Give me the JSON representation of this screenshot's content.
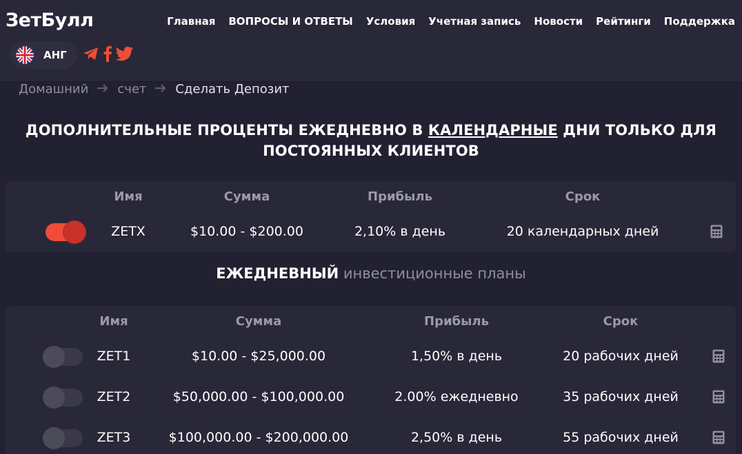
{
  "header": {
    "logo": "ЗетБулл",
    "nav": [
      "Главная",
      "ВОПРОСЫ И ОТВЕТЫ",
      "Условия",
      "Учетная запись",
      "Новости",
      "Рейтинги",
      "Поддержка"
    ],
    "language": "АНГ"
  },
  "breadcrumb": [
    "Домашний",
    "счет",
    "Сделать Депозит"
  ],
  "promo": {
    "title_before": "ДОПОЛНИТЕЛЬНЫЕ ПРОЦЕНТЫ ЕЖЕДНЕВНО В ",
    "title_underlined": "КАЛЕНДАРНЫЕ",
    "title_after": " ДНИ ТОЛЬКО ДЛЯ ПОСТОЯННЫХ КЛИЕНТОВ",
    "columns": [
      "Имя",
      "Сумма",
      "Прибыль",
      "Срок"
    ],
    "plan": {
      "name": "ZETX",
      "amount": "$10.00 - $200.00",
      "profit": "2,10% в день",
      "term": "20 календарных дней",
      "selected": true
    }
  },
  "daily": {
    "title_strong": "ЕЖЕДНЕВНЫЙ",
    "title_rest": "инвестиционные планы",
    "columns": [
      "Имя",
      "Сумма",
      "Прибыль",
      "Срок"
    ],
    "plans": [
      {
        "name": "ZET1",
        "amount": "$10.00 - $25,000.00",
        "profit": "1,50% в день",
        "term": "20 рабочих дней",
        "selected": false
      },
      {
        "name": "ZET2",
        "amount": "$50,000.00 - $100,000.00",
        "profit": "2.00% ежедневно",
        "term": "35 рабочих дней",
        "selected": false
      },
      {
        "name": "ZET3",
        "amount": "$100,000.00 - $200,000.00",
        "profit": "2,50% в день",
        "term": "55 рабочих дней",
        "selected": false
      }
    ]
  },
  "colors": {
    "accent": "#ef4d3a",
    "background": "#222131",
    "card": "#292839",
    "muted": "#8f8da3"
  },
  "icons": [
    "uk-flag-icon",
    "telegram-icon",
    "facebook-icon",
    "twitter-icon",
    "arrow-right-icon",
    "calculator-icon"
  ]
}
